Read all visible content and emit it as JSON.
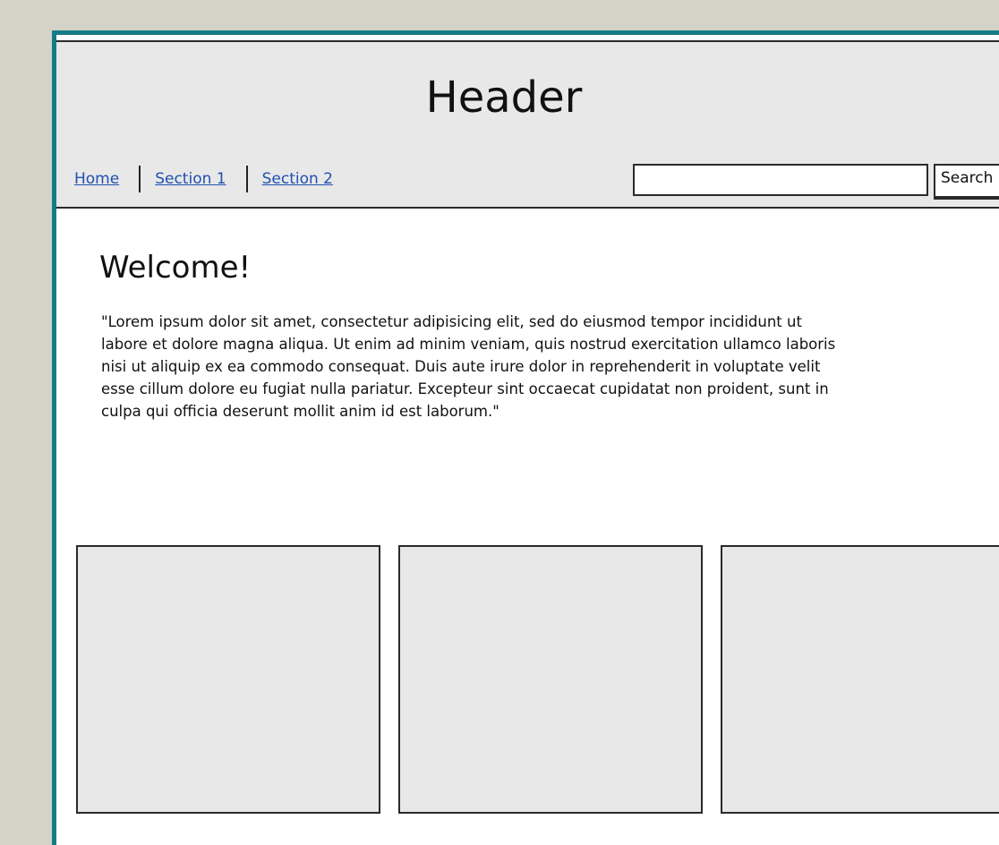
{
  "header": {
    "title": "Header"
  },
  "nav": {
    "items": [
      {
        "label": "Home"
      },
      {
        "label": "Section 1"
      },
      {
        "label": "Section 2"
      }
    ]
  },
  "search": {
    "value": "",
    "button_label": "Search"
  },
  "main": {
    "heading": "Welcome!",
    "paragraph_lines": [
      "\"Lorem ipsum dolor sit amet, consectetur adipisicing elit, sed do eiusmod tempor incididunt ut",
      "labore et dolore magna aliqua. Ut enim ad minim veniam, quis nostrud exercitation ullamco laboris",
      "nisi ut aliquip ex ea commodo consequat. Duis aute irure dolor in reprehenderit in voluptate velit",
      "esse cillum dolore eu fugiat nulla pariatur. Excepteur sint occaecat cupidatat non proident, sunt in",
      "culpa qui officia deserunt mollit anim id est laborum.\""
    ]
  },
  "colors": {
    "page_background": "#d3d3c8",
    "frame_border": "#177a87",
    "header_background": "#e8e8e8",
    "link": "#1f4fb2"
  }
}
